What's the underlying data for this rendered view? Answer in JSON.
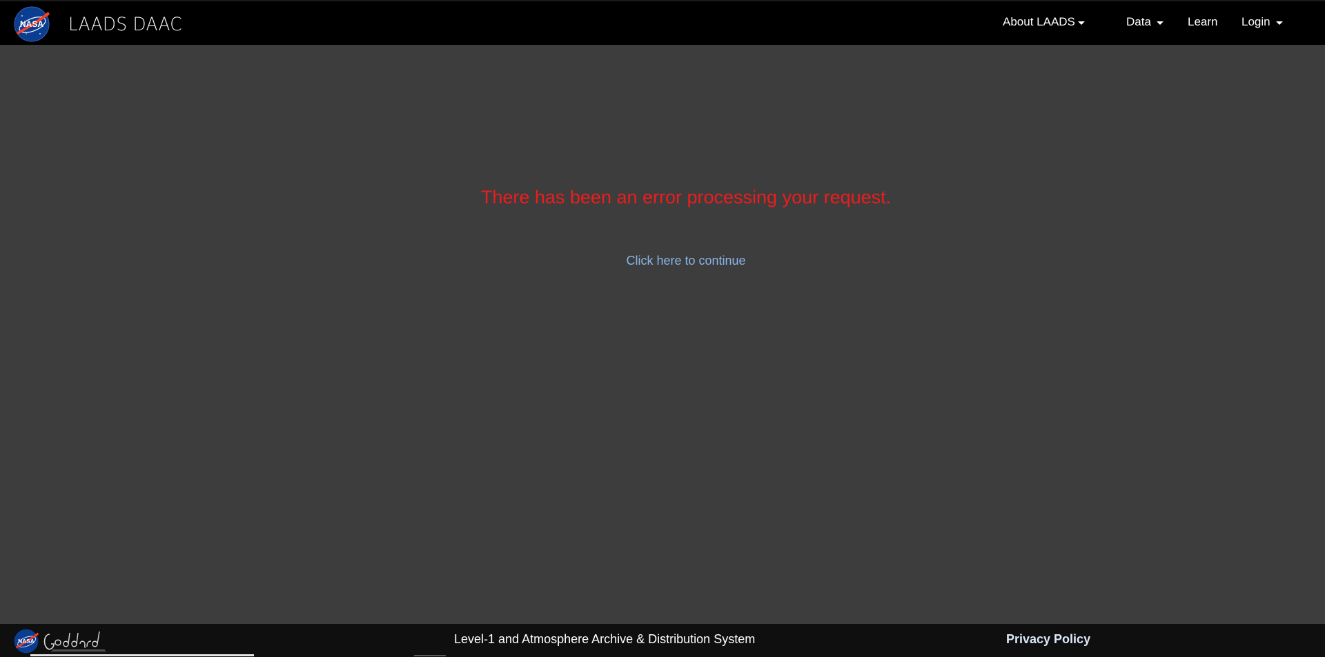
{
  "header": {
    "logo_icon": "nasa-meatball-icon",
    "title": "LAADS DAAC",
    "nav": {
      "about": "About LAADS",
      "data": "Data",
      "learn": "Learn",
      "login": "Login"
    }
  },
  "main": {
    "error_message": "There has been an error processing your request.",
    "continue_link": "Click here to continue"
  },
  "footer": {
    "nasa_logo_icon": "nasa-meatball-icon",
    "goddard_logo_icon": "goddard-logo-icon",
    "title": "Level-1 and Atmosphere Archive & Distribution System",
    "privacy_link": "Privacy Policy"
  },
  "colors": {
    "header_bg": "#000000",
    "page_bg": "#3d3d3d",
    "footer_bg": "#0f0f0f",
    "error_text": "#ee1c1c",
    "link_text": "#8ab4e8"
  }
}
